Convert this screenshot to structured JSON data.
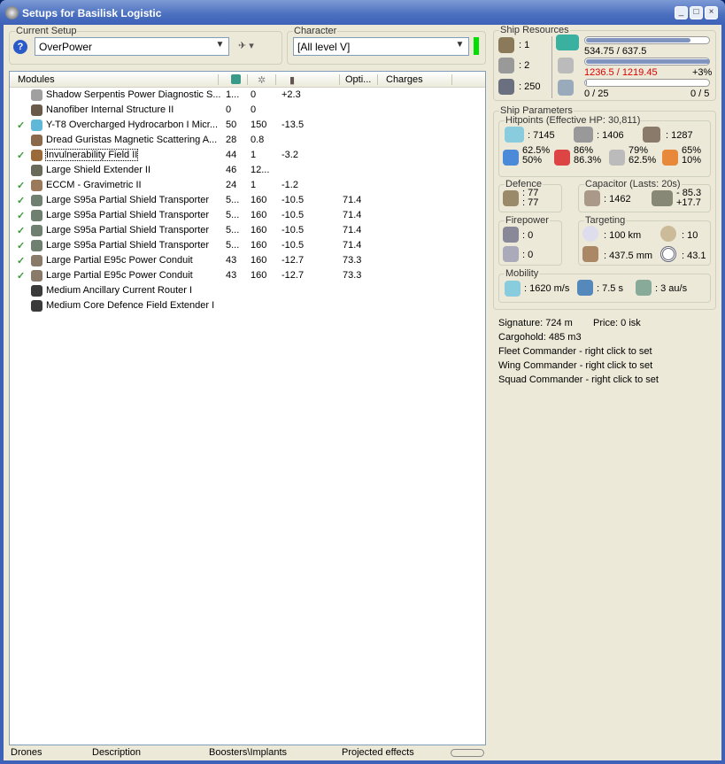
{
  "window": {
    "title": "Setups for Basilisk Logistic"
  },
  "setup": {
    "label": "Current Setup",
    "value": "OverPower"
  },
  "character": {
    "label": "Character",
    "value": "[All level V]",
    "status_color": "#00e000"
  },
  "modules": {
    "headers": [
      "Modules",
      "Opti...",
      "Charges"
    ],
    "rows": [
      {
        "checked": false,
        "name": "Shadow Serpentis Power Diagnostic S...",
        "c1": "1...",
        "c2": "0",
        "c3": "+2.3",
        "opt": "",
        "icon_color": "#a0a0a0"
      },
      {
        "checked": false,
        "name": "Nanofiber Internal Structure II",
        "c1": "0",
        "c2": "0",
        "c3": "",
        "opt": "",
        "icon_color": "#6a5a4a"
      },
      {
        "checked": true,
        "name": "Y-T8 Overcharged Hydrocarbon I Micr...",
        "c1": "50",
        "c2": "150",
        "c3": "-13.5",
        "opt": "",
        "icon_color": "#5fb8d8"
      },
      {
        "checked": false,
        "name": "Dread Guristas Magnetic Scattering A...",
        "c1": "28",
        "c2": "0.8",
        "c3": "",
        "opt": "",
        "icon_color": "#8a6a4a"
      },
      {
        "checked": true,
        "name": "Invulnerability Field II",
        "c1": "44",
        "c2": "1",
        "c3": "-3.2",
        "opt": "",
        "icon_color": "#9a6a3a",
        "selected": true
      },
      {
        "checked": false,
        "name": "Large Shield Extender II",
        "c1": "46",
        "c2": "12...",
        "c3": "",
        "opt": "",
        "icon_color": "#6a6a5a"
      },
      {
        "checked": true,
        "name": "ECCM - Gravimetric II",
        "c1": "24",
        "c2": "1",
        "c3": "-1.2",
        "opt": "",
        "icon_color": "#9a7a5a"
      },
      {
        "checked": true,
        "name": "Large S95a Partial Shield Transporter",
        "c1": "5...",
        "c2": "160",
        "c3": "-10.5",
        "opt": "71.4",
        "icon_color": "#708070"
      },
      {
        "checked": true,
        "name": "Large S95a Partial Shield Transporter",
        "c1": "5...",
        "c2": "160",
        "c3": "-10.5",
        "opt": "71.4",
        "icon_color": "#708070"
      },
      {
        "checked": true,
        "name": "Large S95a Partial Shield Transporter",
        "c1": "5...",
        "c2": "160",
        "c3": "-10.5",
        "opt": "71.4",
        "icon_color": "#708070"
      },
      {
        "checked": true,
        "name": "Large S95a Partial Shield Transporter",
        "c1": "5...",
        "c2": "160",
        "c3": "-10.5",
        "opt": "71.4",
        "icon_color": "#708070"
      },
      {
        "checked": true,
        "name": "Large Partial E95c Power Conduit",
        "c1": "43",
        "c2": "160",
        "c3": "-12.7",
        "opt": "73.3",
        "icon_color": "#8a7a6a"
      },
      {
        "checked": true,
        "name": "Large Partial E95c Power Conduit",
        "c1": "43",
        "c2": "160",
        "c3": "-12.7",
        "opt": "73.3",
        "icon_color": "#8a7a6a"
      },
      {
        "checked": false,
        "name": "Medium Ancillary Current Router I",
        "c1": "",
        "c2": "",
        "c3": "",
        "opt": "",
        "icon_color": "#3a3a3a"
      },
      {
        "checked": false,
        "name": "Medium Core Defence Field Extender I",
        "c1": "",
        "c2": "",
        "c3": "",
        "opt": "",
        "icon_color": "#3a3a3a"
      }
    ]
  },
  "bottom_tabs": [
    "Drones",
    "Description",
    "Boosters\\Implants",
    "Projected effects"
  ],
  "resources": {
    "label": "Ship Resources",
    "turrets": ": 1",
    "launchers": ": 2",
    "drone_bay": ": 250",
    "cpu": {
      "text": "534.75 / 637.5",
      "fill": 0.84
    },
    "power": {
      "text": "1236.5 / 1219.45",
      "extra": "+3%",
      "fill": 1.0
    },
    "calibration": {
      "text": "0 / 25",
      "extra": "0 / 5",
      "fill": 0.0
    }
  },
  "params": {
    "label": "Ship Parameters",
    "hp_label": "Hitpoints (Effective HP: 30,811)",
    "shield": ": 7145",
    "armor": ": 1406",
    "structure": ": 1287",
    "resists": [
      [
        "62.5%",
        "50%"
      ],
      [
        "86%",
        "86.3%"
      ],
      [
        "79%",
        "62.5%"
      ],
      [
        "65%",
        "10%"
      ]
    ],
    "defence_label": "Defence",
    "defence": [
      ": 77",
      ": 77"
    ],
    "cap_label": "Capacitor (Lasts: 20s)",
    "cap": ": 1462",
    "cap_delta": [
      "- 85.3",
      "+17.7"
    ],
    "fire_label": "Firepower",
    "fire": [
      ": 0",
      ": 0"
    ],
    "target_label": "Targeting",
    "range": ": 100 km",
    "max_targets": ": 10",
    "scan_res": ": 437.5 mm",
    "sensor": ": 43.1",
    "mob_label": "Mobility",
    "speed": ": 1620 m/s",
    "align": ": 7.5 s",
    "warp": ": 3 au/s",
    "signature": "Signature: 724 m",
    "price": "Price: 0 isk",
    "cargo": "Cargohold: 485 m3",
    "fleet": "Fleet Commander - right click to set",
    "wing": "Wing Commander - right click to set",
    "squad": "Squad Commander - right click to set"
  }
}
